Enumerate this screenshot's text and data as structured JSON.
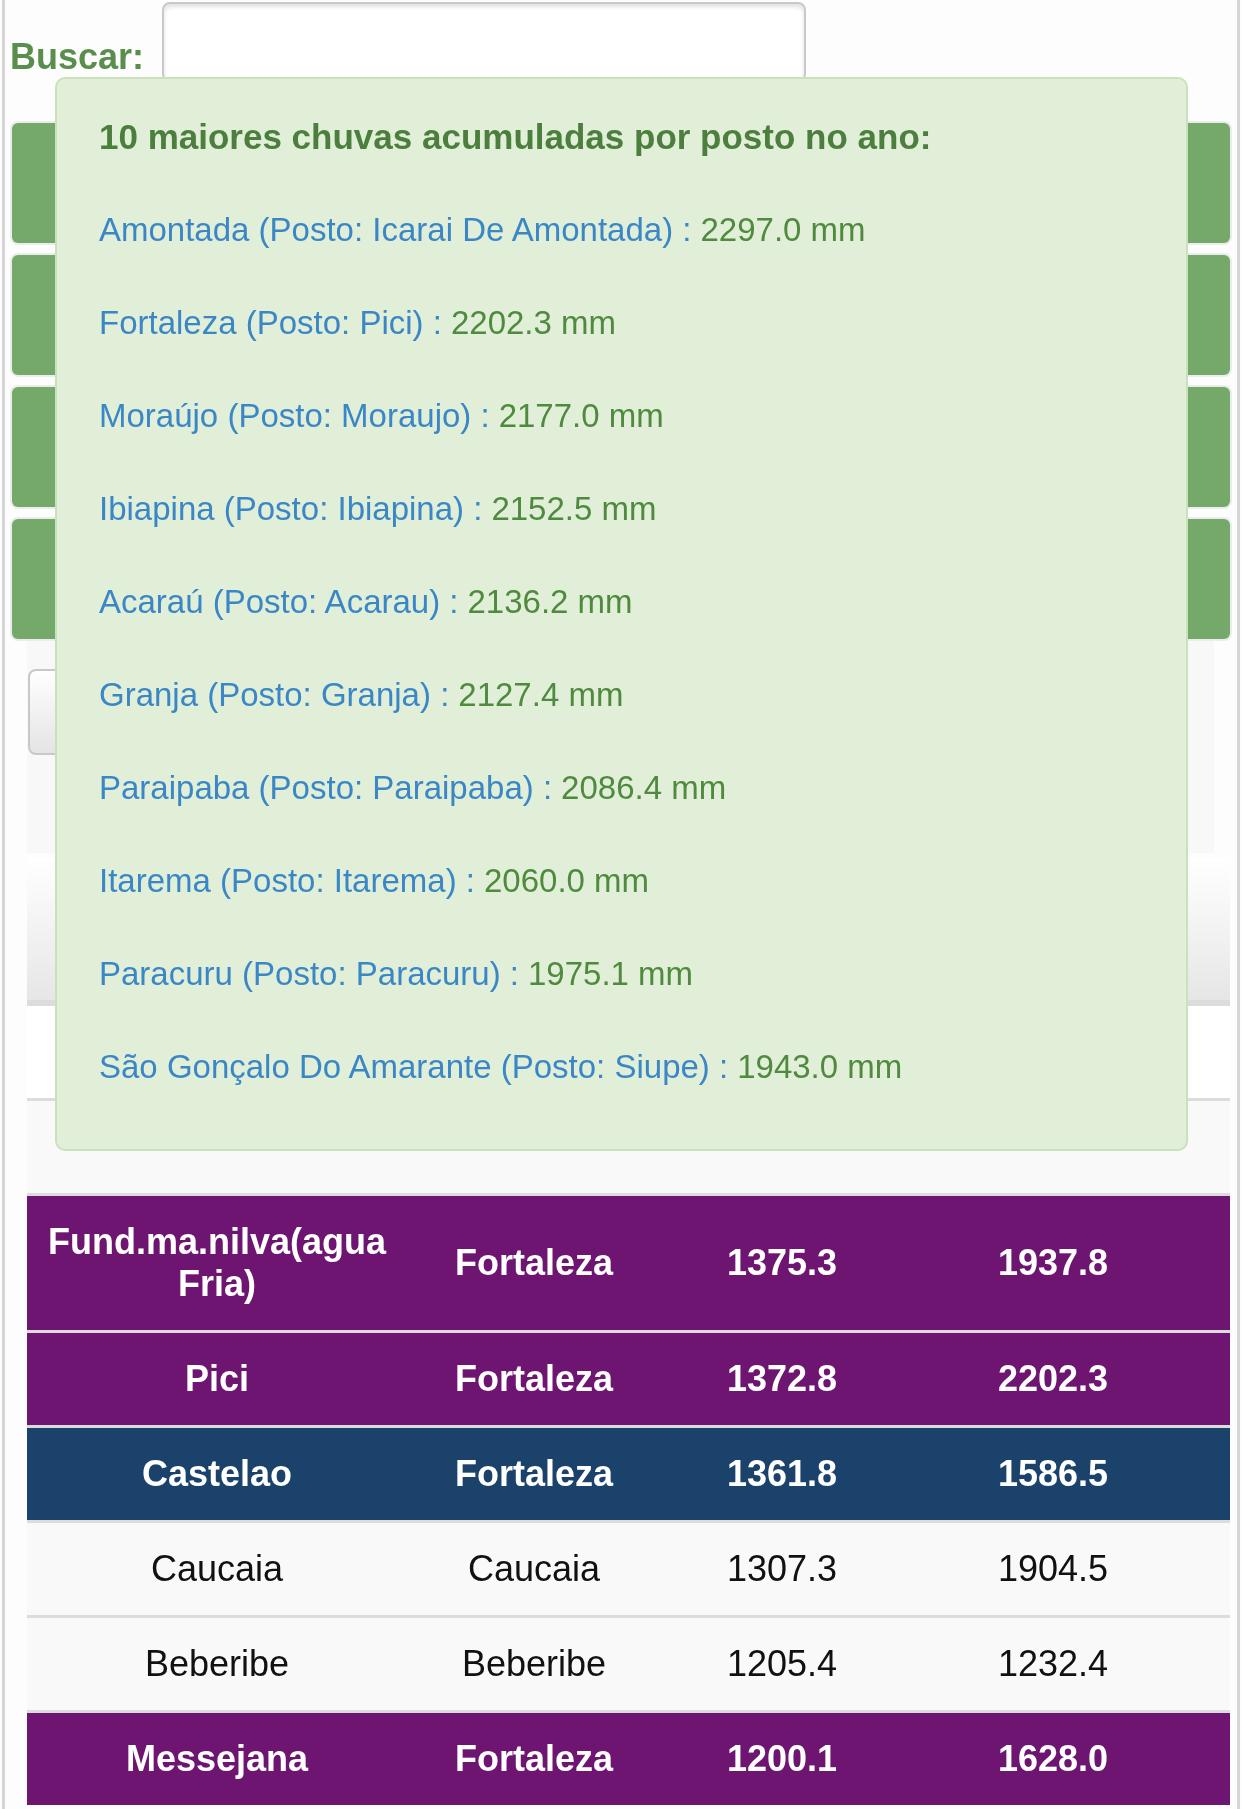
{
  "search": {
    "label": "Buscar:"
  },
  "popup": {
    "title": "10 maiores chuvas acumuladas por posto no ano:",
    "items": [
      {
        "name": "Amontada (Posto: Icarai De Amontada) :",
        "value": "2297.0 mm"
      },
      {
        "name": "Fortaleza (Posto: Pici) :",
        "value": "2202.3 mm"
      },
      {
        "name": "Moraújo (Posto: Moraujo) :",
        "value": "2177.0 mm"
      },
      {
        "name": "Ibiapina (Posto: Ibiapina) :",
        "value": "2152.5 mm"
      },
      {
        "name": "Acaraú (Posto: Acarau) :",
        "value": "2136.2 mm"
      },
      {
        "name": "Granja (Posto: Granja) :",
        "value": "2127.4 mm"
      },
      {
        "name": "Paraipaba (Posto: Paraipaba) :",
        "value": "2086.4 mm"
      },
      {
        "name": "Itarema (Posto: Itarema) :",
        "value": "2060.0 mm"
      },
      {
        "name": "Paracuru (Posto: Paracuru) :",
        "value": "1975.1 mm"
      },
      {
        "name": "São Gonçalo Do Amarante (Posto: Siupe) :",
        "value": "1943.0 mm"
      }
    ]
  },
  "table": {
    "rows": [
      {
        "color": "#ffffff"
      },
      {
        "color": "#f9f9f9"
      },
      {
        "color": "#6d1571",
        "cells": [
          "Fund.ma.nilva(agua Fria)",
          "Fortaleza",
          "1375.3",
          "1937.8"
        ]
      },
      {
        "color": "#6d1571",
        "cells": [
          "Pici",
          "Fortaleza",
          "1372.8",
          "2202.3"
        ]
      },
      {
        "color": "#1b426a",
        "cells": [
          "Castelao",
          "Fortaleza",
          "1361.8",
          "1586.5"
        ]
      },
      {
        "color": "#f9f9f9",
        "cells": [
          "Caucaia",
          "Caucaia",
          "1307.3",
          "1904.5"
        ]
      },
      {
        "color": "#f9f9f9",
        "cells": [
          "Beberibe",
          "Beberibe",
          "1205.4",
          "1232.4"
        ]
      },
      {
        "color": "#6d1571",
        "cells": [
          "Messejana",
          "Fortaleza",
          "1200.1",
          "1628.0"
        ]
      }
    ]
  }
}
